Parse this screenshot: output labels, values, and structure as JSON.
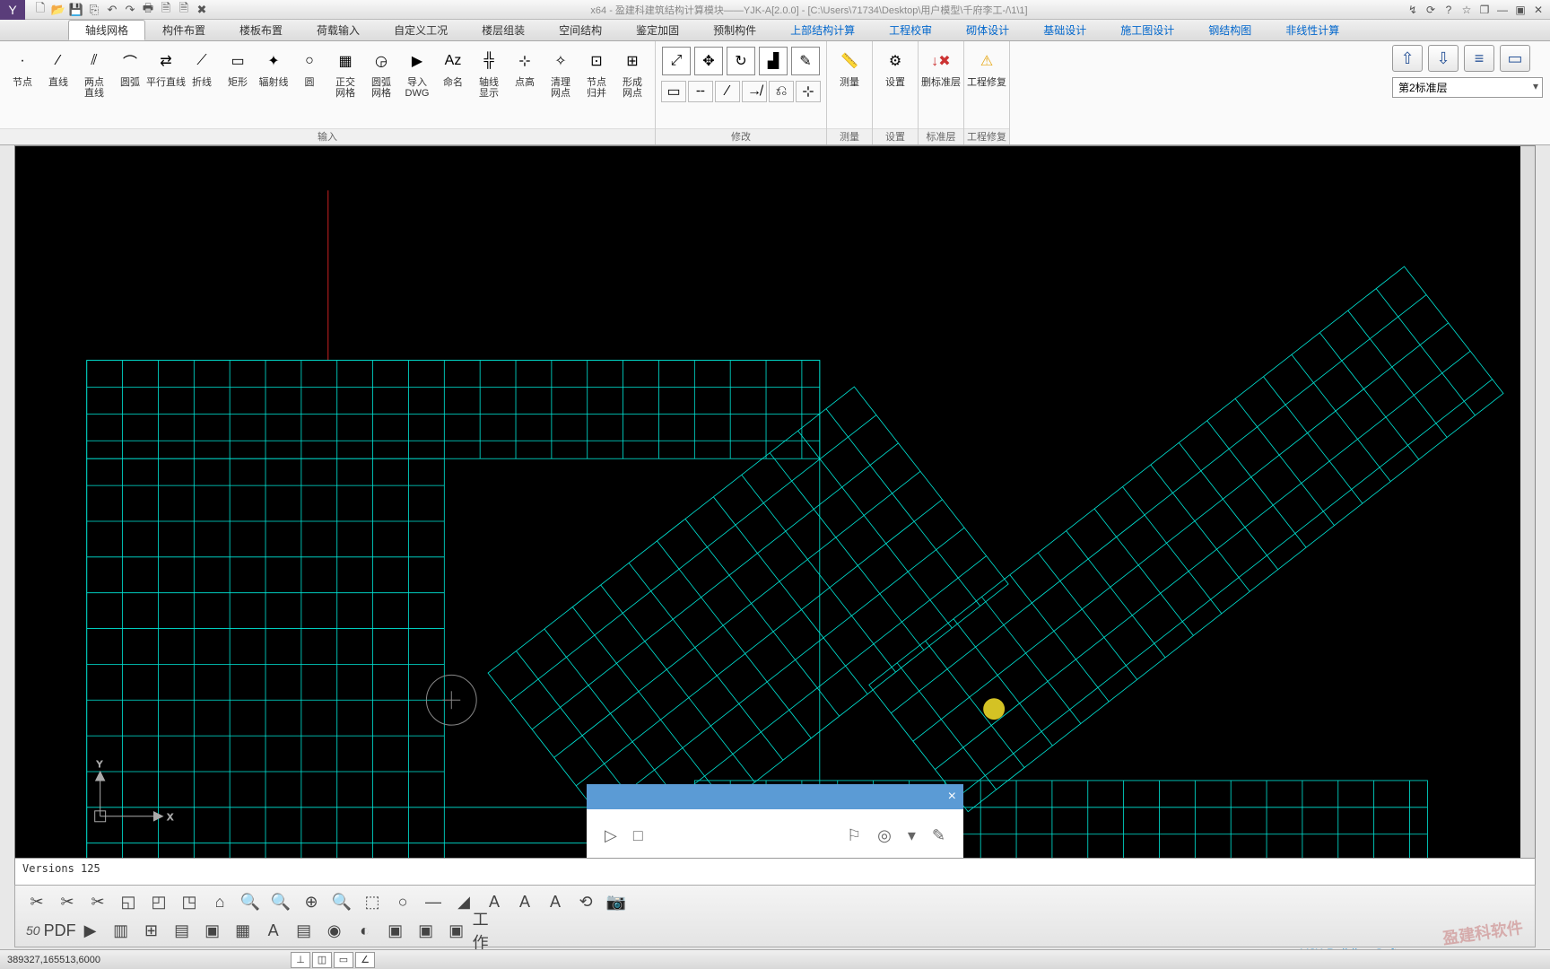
{
  "title": "x64 - 盈建科建筑结构计算模块——YJK-A[2.0.0] - [C:\\Users\\71734\\Desktop\\用户模型\\千府李工-/\\1\\1]",
  "qat_icons": [
    "new",
    "open",
    "save",
    "export",
    "undo",
    "redo",
    "print",
    "doc1",
    "doc2",
    "close"
  ],
  "win_icons": [
    "help1",
    "help2",
    "help3",
    "star",
    "win",
    "min",
    "max",
    "close"
  ],
  "menutabs": [
    {
      "label": "轴线网格",
      "active": true
    },
    {
      "label": "构件布置"
    },
    {
      "label": "楼板布置"
    },
    {
      "label": "荷载输入"
    },
    {
      "label": "自定义工况"
    },
    {
      "label": "楼层组装"
    },
    {
      "label": "空间结构"
    },
    {
      "label": "鉴定加固"
    },
    {
      "label": "预制构件"
    },
    {
      "label": "上部结构计算",
      "blue": true
    },
    {
      "label": "工程校审",
      "blue": true
    },
    {
      "label": "砌体设计",
      "blue": true
    },
    {
      "label": "基础设计",
      "blue": true
    },
    {
      "label": "施工图设计",
      "blue": true
    },
    {
      "label": "钢结构图",
      "blue": true
    },
    {
      "label": "非线性计算",
      "blue": true
    }
  ],
  "ribbon": {
    "group1": {
      "title": "输入",
      "buttons": [
        {
          "ico": "·",
          "lbl": "节点"
        },
        {
          "ico": "⁄",
          "lbl": "直线"
        },
        {
          "ico": "⫽",
          "lbl": "两点\n直线"
        },
        {
          "ico": "⌒",
          "lbl": "圆弧"
        },
        {
          "ico": "⇄",
          "lbl": "平行直线"
        },
        {
          "ico": "⟋",
          "lbl": "折线"
        },
        {
          "ico": "▭",
          "lbl": "矩形"
        },
        {
          "ico": "✦",
          "lbl": "辐射线"
        },
        {
          "ico": "○",
          "lbl": "圆"
        },
        {
          "ico": "▦",
          "lbl": "正交\n网格"
        },
        {
          "ico": "◶",
          "lbl": "圆弧\n网格"
        },
        {
          "ico": "▶",
          "lbl": "导入\nDWG"
        },
        {
          "ico": "Az",
          "lbl": "命名"
        },
        {
          "ico": "╬",
          "lbl": "轴线\n显示"
        },
        {
          "ico": "⊹",
          "lbl": "点高"
        },
        {
          "ico": "✧",
          "lbl": "清理\n网点"
        },
        {
          "ico": "⊡",
          "lbl": "节点\n归并"
        },
        {
          "ico": "⊞",
          "lbl": "形成\n网点"
        }
      ]
    },
    "group2": {
      "title": "修改",
      "big": [
        {
          "ico": "⤢",
          "lbl": ""
        },
        {
          "ico": "✥",
          "lbl": ""
        },
        {
          "ico": "↻",
          "lbl": ""
        },
        {
          "ico": "▟",
          "lbl": ""
        },
        {
          "ico": "✎",
          "lbl": ""
        }
      ],
      "small": [
        {
          "ico": "▭"
        },
        {
          "ico": "╌"
        },
        {
          "ico": "⁄"
        },
        {
          "ico": "↛"
        },
        {
          "ico": "⎌"
        },
        {
          "ico": "⊹"
        }
      ]
    },
    "group3": {
      "title": "测量",
      "btn": {
        "ico": "📏",
        "lbl": "测量"
      }
    },
    "group4": {
      "title": "设置",
      "btn": {
        "ico": "⚙",
        "lbl": "设置"
      }
    },
    "group5": {
      "title": "标准层",
      "btn": {
        "ico": "↓",
        "lbl": "删标准层"
      }
    },
    "group6": {
      "title": "工程修复",
      "btn": {
        "ico": "⚠",
        "lbl": "工程修复"
      }
    }
  },
  "nav": {
    "up": "⇧",
    "down": "⇩",
    "stack": "≡",
    "panel": "▭"
  },
  "floor_dropdown": "第2标准层",
  "cmdlog": "Versions  125",
  "coords": "389327,165513,6000",
  "floatbar_icons": [
    "▷",
    "□",
    "⚐",
    "◎",
    "▾",
    "✎"
  ],
  "bottom_icons_row1": [
    "✂",
    "✂",
    "✂",
    "◱",
    "◰",
    "◳",
    "⌂",
    "🔍",
    "🔍",
    "⊕",
    "🔍",
    "⬚",
    "○",
    "—",
    "◢",
    "A",
    "A",
    "A",
    "⟲",
    "📷"
  ],
  "bottom_icons_row2": [
    "50",
    "PDF",
    "▶",
    "▥",
    "⊞",
    "▤",
    "▣",
    "▦",
    "A",
    "▤",
    "◉",
    "◐",
    "▣",
    "▣",
    "▣",
    "工作"
  ],
  "watermark": "盈建科软件",
  "watermark2": "YJK Building Software",
  "status_toggles": [
    "⊥",
    "◫",
    "▭",
    "∠"
  ]
}
